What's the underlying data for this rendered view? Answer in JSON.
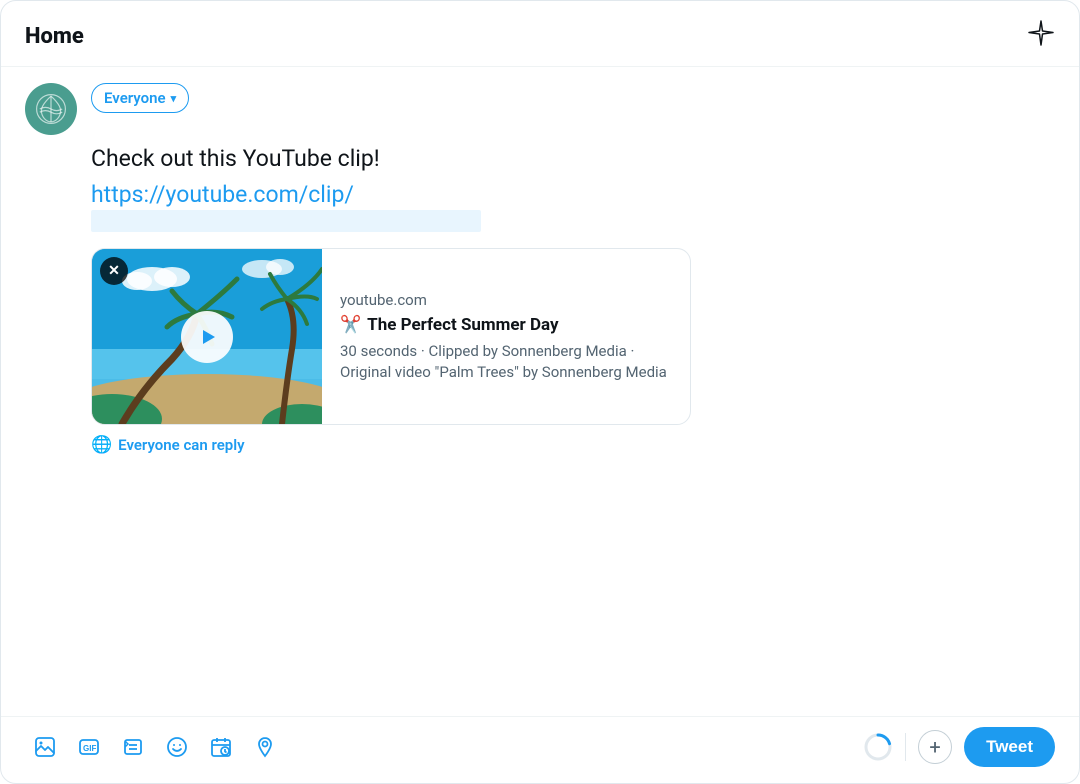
{
  "header": {
    "title": "Home",
    "sparkle_label": "sparkle"
  },
  "compose": {
    "avatar_alt": "user avatar",
    "everyone_label": "Everyone",
    "tweet_text": "Check out this YouTube clip!",
    "tweet_link": "https://youtube.com/clip/",
    "reply_permission": "Everyone can reply"
  },
  "preview_card": {
    "close_label": "✕",
    "domain": "youtube.com",
    "title": "The Perfect Summer Day",
    "scissors": "✂️",
    "meta": "30 seconds · Clipped by Sonnenberg Media · Original video \"Palm Trees\" by Sonnenberg Media"
  },
  "toolbar": {
    "icons": [
      {
        "name": "image-icon",
        "symbol": "🖼"
      },
      {
        "name": "gif-icon",
        "symbol": "GIF"
      },
      {
        "name": "list-icon",
        "symbol": "≡"
      },
      {
        "name": "emoji-icon",
        "symbol": "☺"
      },
      {
        "name": "schedule-icon",
        "symbol": "📅"
      },
      {
        "name": "location-icon",
        "symbol": "📍"
      }
    ],
    "tweet_label": "Tweet"
  }
}
